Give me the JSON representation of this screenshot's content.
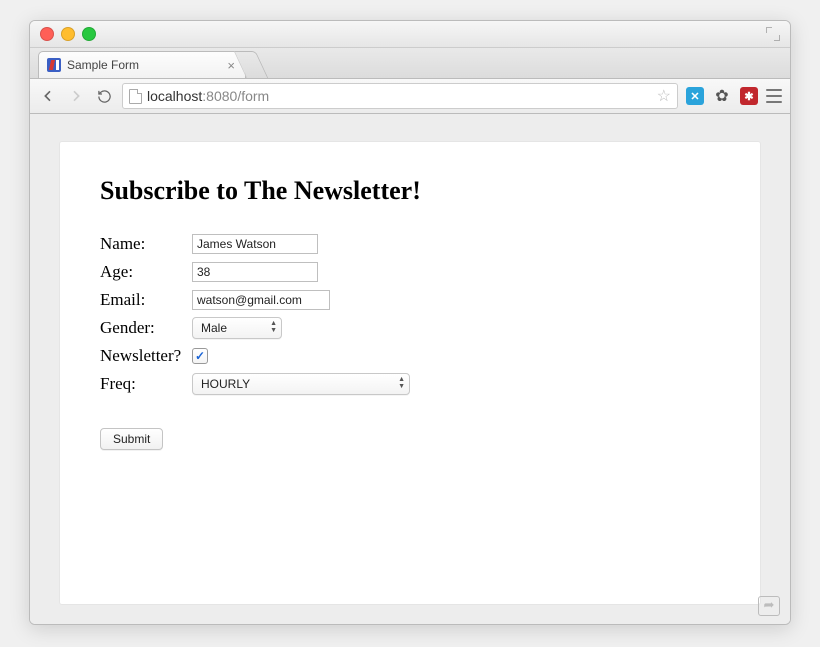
{
  "tab": {
    "title": "Sample Form"
  },
  "url": {
    "host": "localhost",
    "port": ":8080",
    "path": "/form"
  },
  "page": {
    "heading": "Subscribe to The Newsletter!",
    "labels": {
      "name": "Name:",
      "age": "Age:",
      "email": "Email:",
      "gender": "Gender:",
      "newsletter": "Newsletter?",
      "freq": "Freq:"
    },
    "values": {
      "name": "James Watson",
      "age": "38",
      "email": "watson@gmail.com",
      "gender": "Male",
      "newsletter_checked": true,
      "freq": "HOURLY"
    },
    "submit_label": "Submit"
  }
}
